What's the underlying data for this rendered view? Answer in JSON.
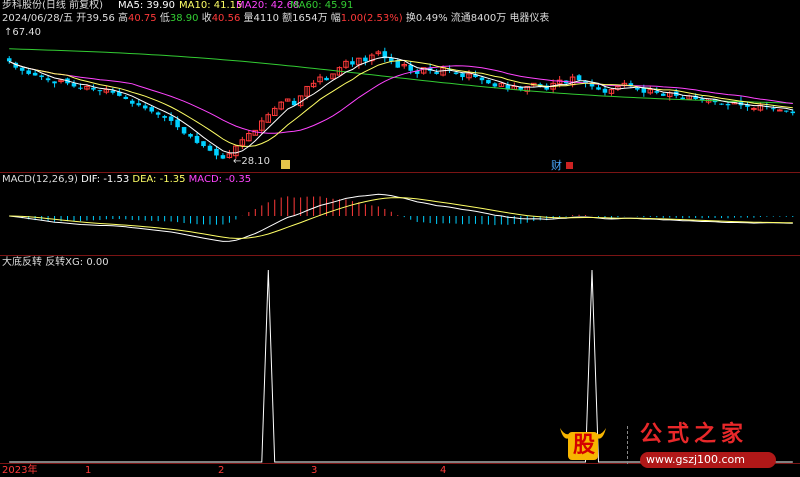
{
  "stock": {
    "title": "步科股份(日线 前复权)",
    "date": "2024/06/28/五",
    "open_label": "开",
    "open": "39.56",
    "high_label": "高",
    "high": "40.75",
    "low_label": "低",
    "low": "38.90",
    "close_label": "收",
    "close": "40.56",
    "volume_label": "量",
    "volume": "4110",
    "amount_label": "额",
    "amount": "1654万",
    "change_label": "幅",
    "change": "1.00(2.53%)",
    "turnover": "换0.49%",
    "float": "流通8400万",
    "sector": "电器仪表"
  },
  "ma": {
    "ma5": "MA5: 39.90",
    "ma10": "MA10: 41.15",
    "ma20": "MA20: 42.68",
    "ma60": "MA60: 45.91"
  },
  "price_labels": {
    "high_mark": "67.40",
    "low_mark": "28.10"
  },
  "event_labels": {
    "finance": "财"
  },
  "macd": {
    "title": "MACD(12,26,9)",
    "dif": "DIF: -1.53",
    "dea": "DEA: -1.35",
    "macd": "MACD: -0.35"
  },
  "indicator": {
    "name": "大底反转",
    "value": "反转XG: 0.00"
  },
  "time_axis": {
    "labels": [
      "2023年",
      "1",
      "2",
      "3",
      "4"
    ]
  },
  "watermark": {
    "logo_char": "股",
    "name": "公式之家",
    "url": "www.gszj100.com"
  },
  "colors": {
    "up": "#ff3a3a",
    "down": "#00d0ff",
    "ma5": "#ffffff",
    "ma10": "#ffff66",
    "ma20": "#ff44ff",
    "ma60": "#33cc33",
    "ma_label": "#ffffff",
    "dif": "#ffffff",
    "dea": "#ffff66"
  },
  "chart_data": [
    {
      "type": "candlestick",
      "title": "步科股份(日线 前复权)",
      "series_names": [
        "MA5",
        "MA10",
        "MA20",
        "MA60"
      ],
      "annotations": [
        "67.40",
        "28.10"
      ],
      "price_range_visible": [
        28.1,
        67.4
      ],
      "close_prices": [
        60,
        58,
        57,
        56,
        55.5,
        55,
        54,
        53,
        54,
        53,
        52,
        51.5,
        52,
        51,
        50.5,
        51,
        50,
        49,
        48,
        46.5,
        46,
        45,
        44,
        43,
        42,
        41,
        39,
        37,
        36,
        34,
        33,
        31.5,
        30,
        29,
        30.5,
        33,
        35,
        37,
        38,
        41,
        43,
        45,
        47,
        48,
        46,
        49,
        52,
        53,
        55,
        54,
        56,
        58,
        60,
        59,
        61,
        60,
        62,
        63,
        61,
        60,
        58,
        59,
        57,
        56,
        58,
        57,
        56,
        58,
        57,
        56,
        55,
        56,
        55,
        54,
        53,
        52,
        53,
        51,
        52,
        51,
        52,
        53,
        52,
        51,
        53,
        54,
        53,
        55,
        54,
        53,
        52,
        51,
        50,
        51,
        52,
        53,
        52,
        51,
        50,
        51,
        50,
        49,
        50,
        49,
        48,
        49,
        48,
        47.5,
        48,
        47,
        46.5,
        46,
        47,
        46,
        45.5,
        45,
        46,
        45.5,
        45,
        44.5,
        44,
        43.5
      ],
      "ma_ranges_approx": {
        "ma60_start": 64,
        "ma60_end": 46
      }
    },
    {
      "type": "line+bar",
      "title": "MACD(12,26,9)",
      "series": [
        {
          "name": "DIF",
          "last": -1.53
        },
        {
          "name": "DEA",
          "last": -1.35
        },
        {
          "name": "MACD",
          "last": -0.35
        }
      ]
    },
    {
      "type": "line",
      "title": "大底反转",
      "series": [
        {
          "name": "反转XG",
          "last": 0.0
        }
      ],
      "signal_positions_index": [
        40,
        90
      ],
      "ylim": [
        0,
        1
      ]
    }
  ]
}
